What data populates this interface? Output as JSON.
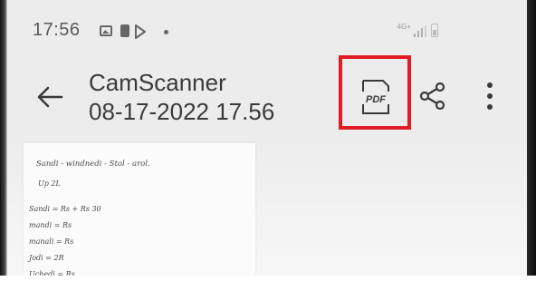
{
  "status_bar": {
    "time": "17:56",
    "network_label": "4G+",
    "icons": [
      "gallery-icon",
      "battery-saver-icon",
      "play-store-icon",
      "notification-dot-icon",
      "network-4g-icon",
      "signal-icon",
      "battery-icon"
    ]
  },
  "toolbar": {
    "title": "CamScanner",
    "subtitle": "08-17-2022 17.56",
    "pdf_label": "PDF",
    "icons": [
      "back-arrow-icon",
      "pdf-icon",
      "share-icon",
      "more-vert-icon"
    ]
  },
  "colors": {
    "highlight": "#e21c24",
    "toolbar_bg": "#ececec",
    "text": "#3a3a3a"
  },
  "document": {
    "handwritten_lines": [
      "Sandi - windnedi - Stol - arol.",
      "Up 2L",
      "Sandi = Rs + Rs 30",
      "mandi = Rs",
      "manali = Rs",
      "Jodi = 2R",
      "Uchedi = Rs"
    ]
  }
}
